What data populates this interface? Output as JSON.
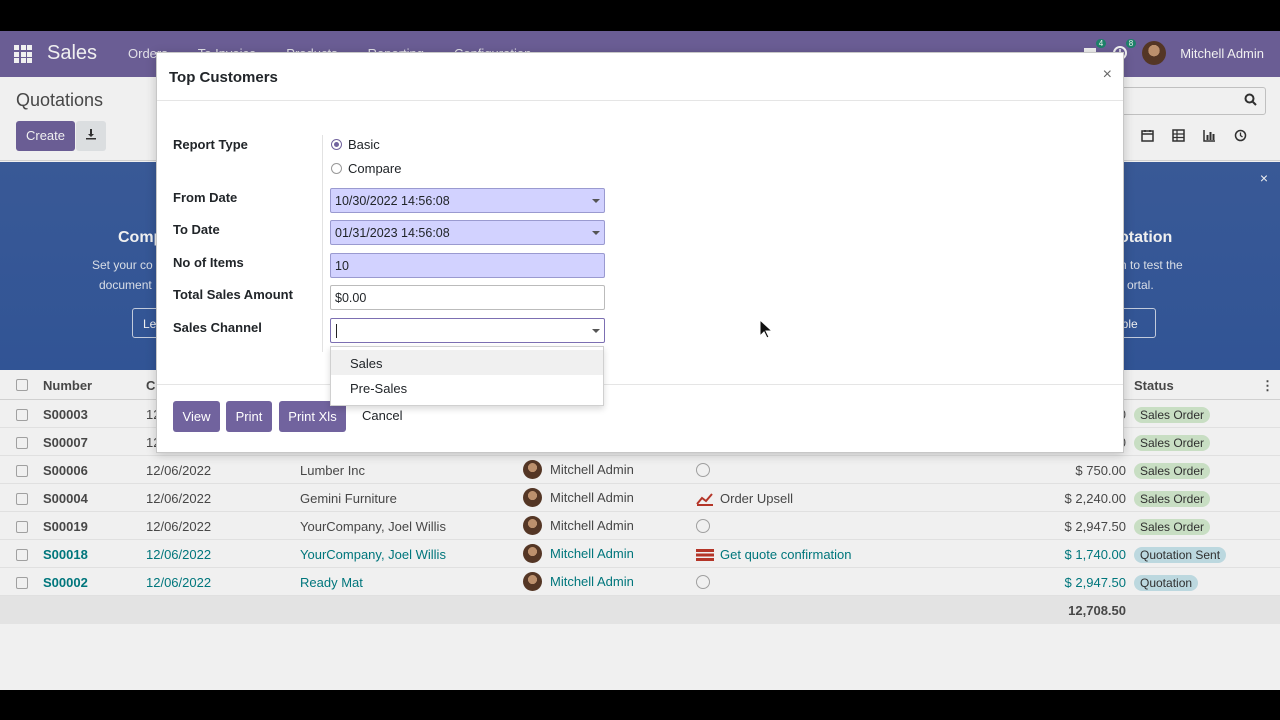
{
  "nav": {
    "brand": "Sales",
    "menu": [
      "Orders",
      "To Invoice",
      "Products",
      "Reporting",
      "Configuration"
    ],
    "chat_badge": "4",
    "activity_badge": "8",
    "user": "Mitchell Admin"
  },
  "control_panel": {
    "title": "Quotations",
    "create_label": "Create",
    "download_icon": "download-icon",
    "search_icon": "search-icon"
  },
  "banner": {
    "left_title": "Comp",
    "left_text_1": "Set your co",
    "left_text_2": "document",
    "left_button": "Le",
    "right_title": "otation",
    "right_text_1": "n to test the",
    "right_text_2": "ortal.",
    "right_button": "nple",
    "close": "×"
  },
  "table": {
    "headers": {
      "number": "Number",
      "date": "C",
      "status": "Status"
    },
    "rows": [
      {
        "number": "S00003",
        "date": "12",
        "customer": "",
        "salesperson": "",
        "activity": "",
        "total": "0",
        "status": "Sales Order"
      },
      {
        "number": "S00007",
        "date": "12",
        "customer": "",
        "salesperson": "",
        "activity": "",
        "total": "0",
        "status": "Sales Order"
      },
      {
        "number": "S00006",
        "date": "12/06/2022",
        "customer": "Lumber Inc",
        "salesperson": "Mitchell Admin",
        "activity": "",
        "total": "$ 750.00",
        "status": "Sales Order"
      },
      {
        "number": "S00004",
        "date": "12/06/2022",
        "customer": "Gemini Furniture",
        "salesperson": "Mitchell Admin",
        "activity": "Order Upsell",
        "total": "$ 2,240.00",
        "status": "Sales Order"
      },
      {
        "number": "S00019",
        "date": "12/06/2022",
        "customer": "YourCompany, Joel Willis",
        "salesperson": "Mitchell Admin",
        "activity": "",
        "total": "$ 2,947.50",
        "status": "Sales Order"
      },
      {
        "number": "S00018",
        "date": "12/06/2022",
        "customer": "YourCompany, Joel Willis",
        "salesperson": "Mitchell Admin",
        "activity": "Get quote confirmation",
        "total": "$ 1,740.00",
        "status": "Quotation Sent"
      },
      {
        "number": "S00002",
        "date": "12/06/2022",
        "customer": "Ready Mat",
        "salesperson": "Mitchell Admin",
        "activity": "",
        "total": "$ 2,947.50",
        "status": "Quotation"
      }
    ],
    "sum_total": "12,708.50"
  },
  "modal": {
    "title": "Top Customers",
    "close": "×",
    "labels": {
      "report_type": "Report Type",
      "from_date": "From Date",
      "to_date": "To Date",
      "no_of_items": "No of Items",
      "total_sales_amount": "Total Sales Amount",
      "sales_channel": "Sales Channel"
    },
    "report_type_options": [
      "Basic",
      "Compare"
    ],
    "report_type_selected": "Basic",
    "from_date": "10/30/2022 14:56:08",
    "to_date": "01/31/2023 14:56:08",
    "no_of_items": "10",
    "total_sales_amount": "$0.00",
    "sales_channel": "",
    "dropdown_options": [
      "Sales",
      "Pre-Sales"
    ],
    "buttons": {
      "view": "View",
      "print": "Print",
      "print_xls": "Print Xls",
      "cancel": "Cancel"
    }
  },
  "colors": {
    "brand": "#71639e",
    "banner": "#3d5fa0",
    "required_field": "#d2d2ff",
    "teal_row": "#017e84"
  }
}
